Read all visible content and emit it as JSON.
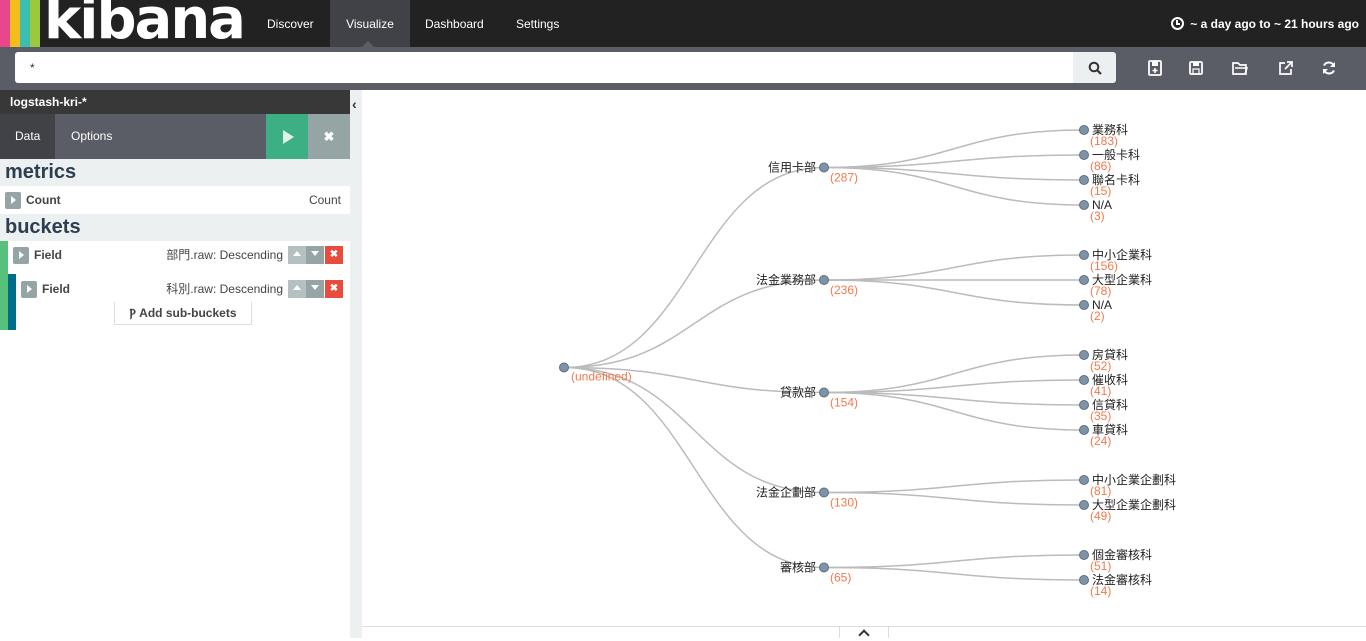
{
  "app": {
    "brand_colors": [
      "#f04e98",
      "#fed10a",
      "#0096d6",
      "#3ebeb0"
    ],
    "logo_text": "kibana"
  },
  "nav": {
    "tabs": [
      {
        "label": "Discover"
      },
      {
        "label": "Visualize",
        "active": true
      },
      {
        "label": "Dashboard"
      },
      {
        "label": "Settings"
      }
    ],
    "time_range": "~ a day ago to ~ 21 hours ago"
  },
  "search": {
    "query": "*",
    "actions": [
      "new-visualization-icon",
      "save-icon",
      "open-icon",
      "share-icon",
      "refresh-icon"
    ]
  },
  "sidebar": {
    "index_pattern": "logstash-kri-*",
    "tabs": [
      {
        "label": "Data",
        "active": true
      },
      {
        "label": "Options"
      }
    ],
    "metrics_title": "metrics",
    "metrics": [
      {
        "title": "Count",
        "description": "Count"
      }
    ],
    "buckets_title": "buckets",
    "buckets": [
      {
        "title": "Field",
        "description": "部門.raw: Descending",
        "color": "#57c17b"
      },
      {
        "title": "Field",
        "description": "科別.raw: Descending",
        "color": "#006e8a"
      }
    ],
    "add_sub_buckets": "Add sub-buckets"
  },
  "chart_data": {
    "type": "tree",
    "root": {
      "label": "",
      "count_label": "(undefined)"
    },
    "nodes": [
      {
        "label": "信用卡部",
        "count": 287,
        "children": [
          {
            "label": "業務科",
            "count": 183
          },
          {
            "label": "一般卡科",
            "count": 86
          },
          {
            "label": "聯名卡科",
            "count": 15
          },
          {
            "label": "N/A",
            "count": 3
          }
        ]
      },
      {
        "label": "法金業務部",
        "count": 236,
        "children": [
          {
            "label": "中小企業科",
            "count": 156
          },
          {
            "label": "大型企業科",
            "count": 78
          },
          {
            "label": "N/A",
            "count": 2
          }
        ]
      },
      {
        "label": "貸款部",
        "count": 154,
        "children": [
          {
            "label": "房貸科",
            "count": 52
          },
          {
            "label": "催收科",
            "count": 41
          },
          {
            "label": "信貸科",
            "count": 35
          },
          {
            "label": "車貸科",
            "count": 24
          }
        ]
      },
      {
        "label": "法金企劃部",
        "count": 130,
        "children": [
          {
            "label": "中小企業企劃科",
            "count": 81
          },
          {
            "label": "大型企業企劃科",
            "count": 49
          }
        ]
      },
      {
        "label": "審核部",
        "count": 65,
        "children": [
          {
            "label": "個金審核科",
            "count": 51
          },
          {
            "label": "法金審核科",
            "count": 14
          }
        ]
      }
    ],
    "colors": {
      "link": "#bbbbbb",
      "node": "#7f93a6",
      "count": "#f07a4f",
      "label": "#222222"
    }
  }
}
